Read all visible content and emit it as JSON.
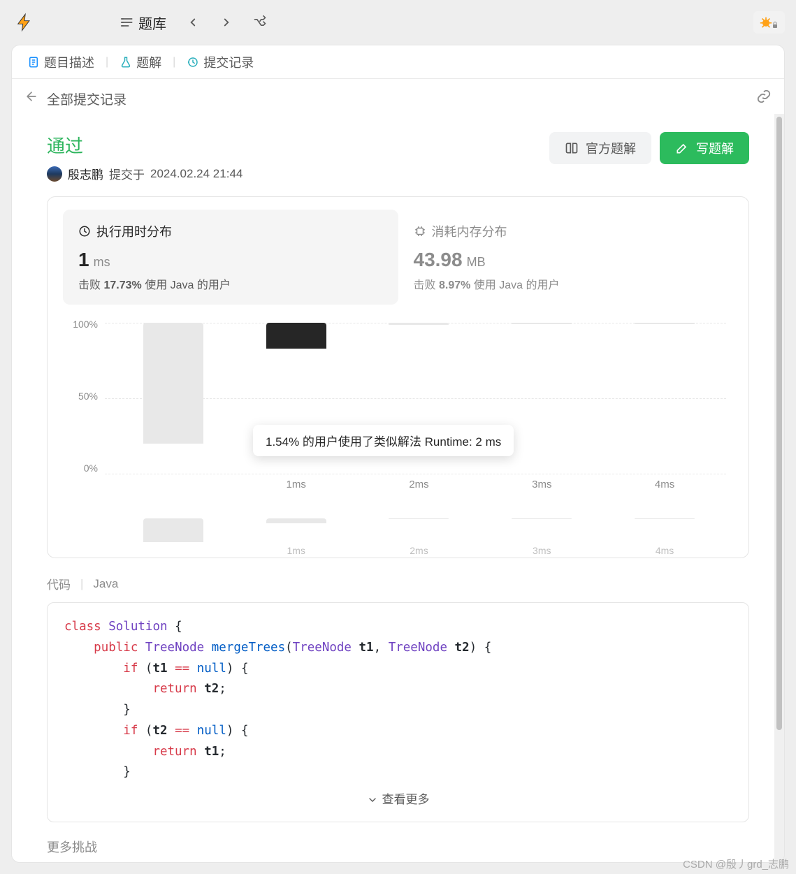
{
  "toolbar": {
    "problemset_label": "题库"
  },
  "tabs": {
    "description": "题目描述",
    "solution": "题解",
    "submissions": "提交记录"
  },
  "subbar": {
    "all_submissions": "全部提交记录"
  },
  "status": {
    "label": "通过",
    "user": "殷志鹏",
    "submitted_prefix": "提交于",
    "submitted_at": "2024.02.24 21:44"
  },
  "actions": {
    "official": "官方题解",
    "write": "写题解"
  },
  "stats": {
    "runtime": {
      "title": "执行用时分布",
      "value": "1",
      "unit": "ms",
      "beats_prefix": "击败",
      "beats_pct": "17.73%",
      "beats_suffix": "使用 Java 的用户"
    },
    "memory": {
      "title": "消耗内存分布",
      "value": "43.98",
      "unit": "MB",
      "beats_prefix": "击败",
      "beats_pct": "8.97%",
      "beats_suffix": "使用 Java 的用户"
    }
  },
  "tooltip": {
    "text": "1.54% 的用户使用了类似解法 Runtime: 2 ms"
  },
  "chart_data": {
    "type": "bar",
    "y_ticks": [
      "100%",
      "50%",
      "0%"
    ],
    "categories": [
      "",
      "1ms",
      "2ms",
      "3ms",
      "4ms"
    ],
    "values_pct": [
      80,
      17,
      1.5,
      1,
      1
    ],
    "highlight_index": 1,
    "thumb": {
      "categories": [
        "",
        "1ms",
        "2ms",
        "3ms",
        "4ms"
      ],
      "values_pct": [
        100,
        20,
        4,
        3,
        3
      ]
    }
  },
  "code": {
    "label": "代码",
    "language": "Java",
    "see_more": "查看更多"
  },
  "more_section": "更多挑战",
  "watermark": "CSDN @殷丿grd_志鹏"
}
